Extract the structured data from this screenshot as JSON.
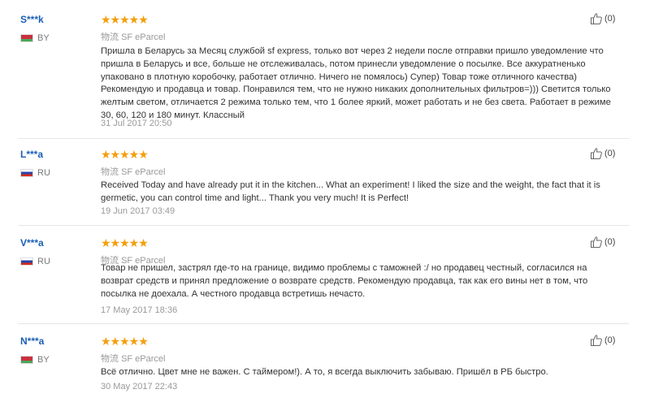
{
  "reviews": [
    {
      "user": "S***k",
      "country": "BY",
      "stars": "★★★★★",
      "logistics_label": "物流",
      "logistics_value": "SF eParcel",
      "text": "Пришла в Беларусь за Месяц службой sf express, только вот через 2 недели после отправки пришло уведомление что пришла в Беларусь и все, больше не отслеживалась, потом принесли уведомление о посылке. Все аккуратненько упаковано в плотную коробочку, работает отлично. Ничего не помялось) Супер) Товар тоже отличного качества) Рекомендую и продавца и товар. Понравился тем, что не нужно никаких дополнительных фильтров=))) Светится только желтым светом, отличается 2 режима только тем, что 1 более яркий, может работать и не без света. Работает в режиме 30, 60, 120 и 180 минут. Классный",
      "date": "31 Jul 2017 20:50",
      "helpful": "(0)"
    },
    {
      "user": "L***a",
      "country": "RU",
      "stars": "★★★★★",
      "logistics_label": "物流",
      "logistics_value": "SF eParcel",
      "text": "Received Today and have already put it in the kitchen... What an experiment! I liked the size and the weight, the fact that it is germetic, you can control time and light... Thank you very much! It is Perfect!",
      "date": "19 Jun 2017 03:49",
      "helpful": "(0)"
    },
    {
      "user": "V***a",
      "country": "RU",
      "stars": "★★★★★",
      "logistics_label": "物流",
      "logistics_value": "SF eParcel",
      "text": "Товар не пришел, застрял где-то на границе, видимо проблемы с таможней :/ но продавец честный, согласился на возврат средств и принял предложение о возврате средств. Рекомендую продавца, так как его вины нет в том, что посылка не доехала. А честного продавца встретишь нечасто.",
      "date": "17 May 2017 18:36",
      "helpful": "(0)"
    },
    {
      "user": "N***a",
      "country": "BY",
      "stars": "★★★★★",
      "logistics_label": "物流",
      "logistics_value": "SF eParcel",
      "text": "Всё отлично. Цвет мне не важен. С таймером!). А то, я всегда выключить забываю. Пришёл в РБ быстро.",
      "date": "30 May 2017 22:43",
      "helpful": "(0)"
    }
  ]
}
